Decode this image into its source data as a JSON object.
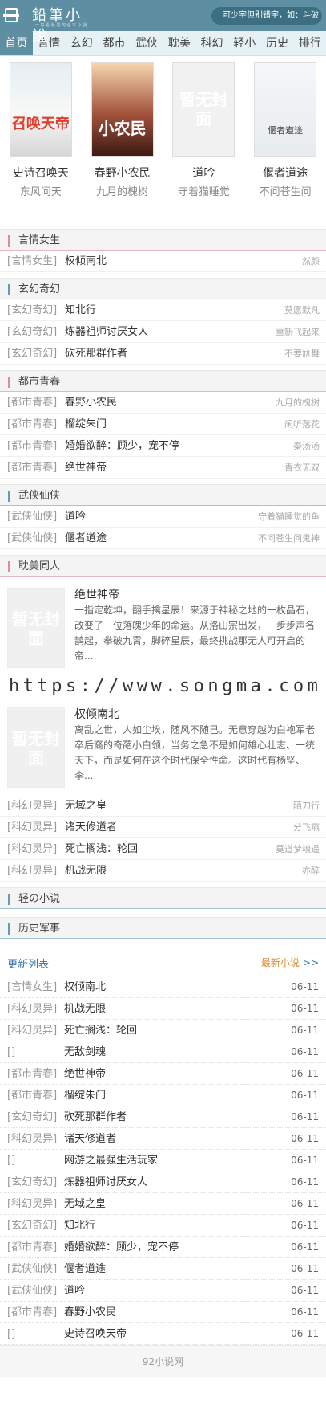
{
  "header": {
    "logo_title": "鉛筆小說",
    "logo_slogan": "一 好 看 最 愛 的 全 本 小 說",
    "search_placeholder": "可少字但别错字，如：斗破"
  },
  "nav": [
    {
      "label": "首页",
      "active": true
    },
    {
      "label": "言情"
    },
    {
      "label": "玄幻"
    },
    {
      "label": "都市"
    },
    {
      "label": "武侠"
    },
    {
      "label": "耽美"
    },
    {
      "label": "科幻"
    },
    {
      "label": "轻小"
    },
    {
      "label": "历史"
    },
    {
      "label": "排行"
    }
  ],
  "covers": [
    {
      "title": "史诗召唤天",
      "author": "东风问天",
      "cover_text": "召唤天帝"
    },
    {
      "title": "春野小农民",
      "author": "九月的槐树",
      "cover_text": "小农民"
    },
    {
      "title": "道吟",
      "author": "守着猫睡觉",
      "cover_text": "暂无封面"
    },
    {
      "title": "偃者道途",
      "author": "不问苍生问",
      "cover_text": "偃者道途"
    }
  ],
  "sections": {
    "yanqing": {
      "title": "言情女生",
      "rows": [
        {
          "tag": "[言情女生]",
          "name": "权倾南北",
          "author": "然颜"
        }
      ]
    },
    "xuanhuan": {
      "title": "玄幻奇幻",
      "rows": [
        {
          "tag": "[玄幻奇幻]",
          "name": "知北行",
          "author": "莫愿默凡"
        },
        {
          "tag": "[玄幻奇幻]",
          "name": "炼器祖师讨厌女人",
          "author": "重新飞起来"
        },
        {
          "tag": "[玄幻奇幻]",
          "name": "砍死那群作者",
          "author": "不要尬舞"
        }
      ]
    },
    "dushi": {
      "title": "都市青春",
      "rows": [
        {
          "tag": "[都市青春]",
          "name": "春野小农民",
          "author": "九月的槐树"
        },
        {
          "tag": "[都市青春]",
          "name": "榴绽朱门",
          "author": "闲听落花"
        },
        {
          "tag": "[都市青春]",
          "name": "婚婚欲醉：顾少，宠不停",
          "author": "秦汤汤"
        },
        {
          "tag": "[都市青春]",
          "name": "绝世神帝",
          "author": "青衣无双"
        }
      ]
    },
    "wuxia": {
      "title": "武侠仙侠",
      "rows": [
        {
          "tag": "[武侠仙侠]",
          "name": "道吟",
          "author": "守着猫睡觉的鱼"
        },
        {
          "tag": "[武侠仙侠]",
          "name": "偃者道途",
          "author": "不问苍生问鬼神"
        }
      ]
    },
    "danmei": {
      "title": "耽美同人"
    },
    "kehuan": {
      "rows": [
        {
          "tag": "[科幻灵异]",
          "name": "无域之皇",
          "author": "陌刀行"
        },
        {
          "tag": "[科幻灵异]",
          "name": "诸天修道者",
          "author": "分飞燕"
        },
        {
          "tag": "[科幻灵异]",
          "name": "死亡搁浅：轮回",
          "author": "莫道梦魂遥"
        },
        {
          "tag": "[科幻灵异]",
          "name": "机战无限",
          "author": "亦醉"
        }
      ]
    },
    "qingxiaoshuo": {
      "title": "轻の小说"
    },
    "lishi": {
      "title": "历史军事"
    }
  },
  "featured": [
    {
      "title": "绝世神帝",
      "cover_text": "暂无封面",
      "desc": "一指定乾坤，翻手擒星辰！来源于神秘之地的一枚晶石，改变了一位落魄少年的命运。从洛山宗出发，一步步声名鹊起，拳破九霄，脚碎星辰，最终挑战那无人可开启的帝..."
    },
    {
      "title": "权倾南北",
      "cover_text": "暂无封面",
      "desc": "离乱之世，人如尘埃，随风不随己。无意穿越为白袍军老卒后裔的奇葩小白领，当务之急不是如何雄心壮志、一统天下，而是如何在这个时代保全性命。这时代有杨坚、李..."
    }
  ],
  "watermark": "https://www.songma.com",
  "updates": {
    "title": "更新列表",
    "latest_label": "最新小说",
    "arrow": ">>",
    "rows": [
      {
        "tag": "[言情女生]",
        "name": "权倾南北",
        "date": "06-11"
      },
      {
        "tag": "[科幻灵异]",
        "name": "机战无限",
        "date": "06-11"
      },
      {
        "tag": "[科幻灵异]",
        "name": "死亡搁浅：轮回",
        "date": "06-11"
      },
      {
        "tag": "[]",
        "name": "无敌剑魂",
        "date": "06-11"
      },
      {
        "tag": "[都市青春]",
        "name": "绝世神帝",
        "date": "06-11"
      },
      {
        "tag": "[都市青春]",
        "name": "榴绽朱门",
        "date": "06-11"
      },
      {
        "tag": "[玄幻奇幻]",
        "name": "砍死那群作者",
        "date": "06-11"
      },
      {
        "tag": "[科幻灵异]",
        "name": "诸天修道者",
        "date": "06-11"
      },
      {
        "tag": "[]",
        "name": "网游之最强生活玩家",
        "date": "06-11"
      },
      {
        "tag": "[玄幻奇幻]",
        "name": "炼器祖师讨厌女人",
        "date": "06-11"
      },
      {
        "tag": "[科幻灵异]",
        "name": "无域之皇",
        "date": "06-11"
      },
      {
        "tag": "[玄幻奇幻]",
        "name": "知北行",
        "date": "06-11"
      },
      {
        "tag": "[都市青春]",
        "name": "婚婚欲醉：顾少，宠不停",
        "date": "06-11"
      },
      {
        "tag": "[武侠仙侠]",
        "name": "偃者道途",
        "date": "06-11"
      },
      {
        "tag": "[武侠仙侠]",
        "name": "道吟",
        "date": "06-11"
      },
      {
        "tag": "[都市青春]",
        "name": "春野小农民",
        "date": "06-11"
      },
      {
        "tag": "[]",
        "name": "史诗召唤天帝",
        "date": "06-11"
      }
    ]
  },
  "footer": "92小说网"
}
